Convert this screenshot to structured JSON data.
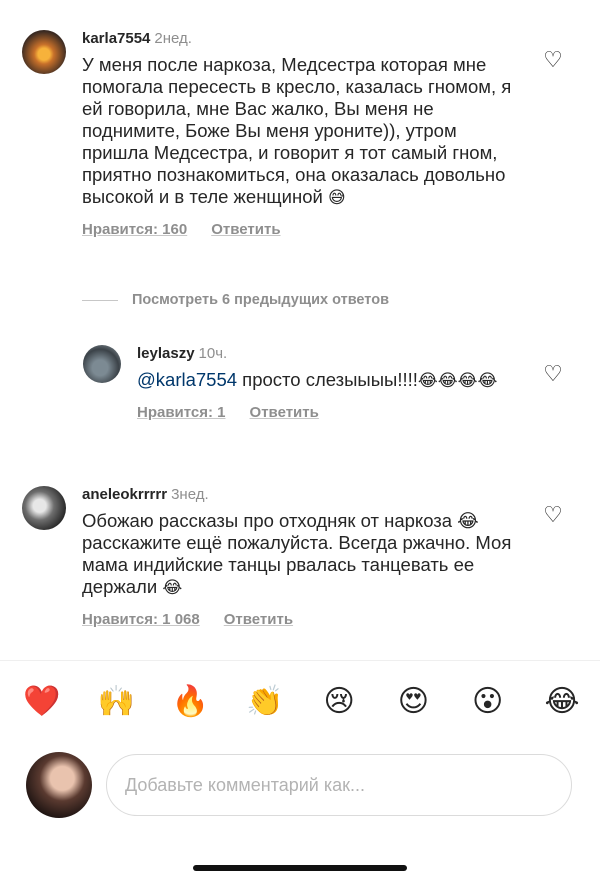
{
  "comments": [
    {
      "username": "karla7554",
      "time": "2нед.",
      "text": "У меня после наркоза, Медсестра которая мне помогала пересесть в кресло, казалась гномом, я ей говорила, мне Вас жалко, Вы меня не поднимите, Боже Вы меня уроните)), утром пришла Медсестра, и говорит я тот самый гном, приятно познакомиться, она оказалась  довольно высокой и в теле женщиной",
      "emoji": "😅",
      "likes": "Нравится: 160",
      "reply": "Ответить"
    },
    {
      "username": "leylaszy",
      "time": "10ч.",
      "mention": "@karla7554",
      "text": " просто слезыыыы!!!!",
      "emoji": "😂😂😂😂",
      "likes": "Нравится: 1",
      "reply": "Ответить"
    },
    {
      "username": "aneleokrrrrr",
      "time": "3нед.",
      "text": "Обожаю рассказы про отходняк от наркоза 😂 расскажите ещё пожалуйста. Всегда ржачно. Моя мама индийские танцы рвалась танцевать ее держали",
      "emoji": "😂",
      "likes": "Нравится: 1 068",
      "reply": "Ответить"
    }
  ],
  "view_more": "Посмотреть 6 предыдущих ответов",
  "reactions": [
    "❤️",
    "🙌",
    "🔥",
    "👏",
    "😢",
    "😍",
    "😮",
    "😂"
  ],
  "composer": {
    "placeholder": "Добавьте комментарий как..."
  },
  "icons": {
    "like": "heart-outline-icon"
  }
}
